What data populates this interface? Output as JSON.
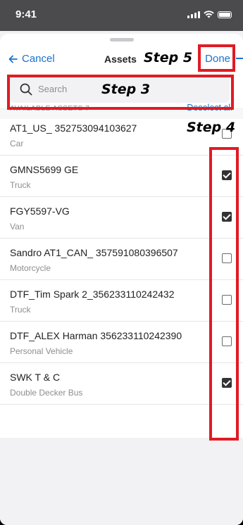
{
  "status_bar": {
    "time": "9:41"
  },
  "nav": {
    "cancel_label": "Cancel",
    "title": "Assets",
    "done_label": "Done"
  },
  "search": {
    "placeholder": "Search"
  },
  "section": {
    "available_label": "AVAILABLE ASSETS 7",
    "deselect_all_label": "Deselect all"
  },
  "assets": [
    {
      "name": "AT1_US_ 352753094103627",
      "type": "Car",
      "checked": false
    },
    {
      "name": "GMNS5699 GE",
      "type": "Truck",
      "checked": true
    },
    {
      "name": "FGY5597-VG",
      "type": "Van",
      "checked": true
    },
    {
      "name": "Sandro AT1_CAN_ 357591080396507",
      "type": "Motorcycle",
      "checked": false
    },
    {
      "name": "DTF_Tim Spark 2_356233110242432",
      "type": "Truck",
      "checked": false
    },
    {
      "name": "DTF_ALEX Harman 356233110242390",
      "type": "Personal Vehicle",
      "checked": false
    },
    {
      "name": "SWK T & C",
      "type": "Double Decker Bus",
      "checked": true
    }
  ],
  "annotations": {
    "step3": "Step 3",
    "step4": "Step 4",
    "step5": "Step 5",
    "color": "#e01b24"
  },
  "colors": {
    "accent": "#1a73c9",
    "status_bar": "#4b4b4d"
  }
}
